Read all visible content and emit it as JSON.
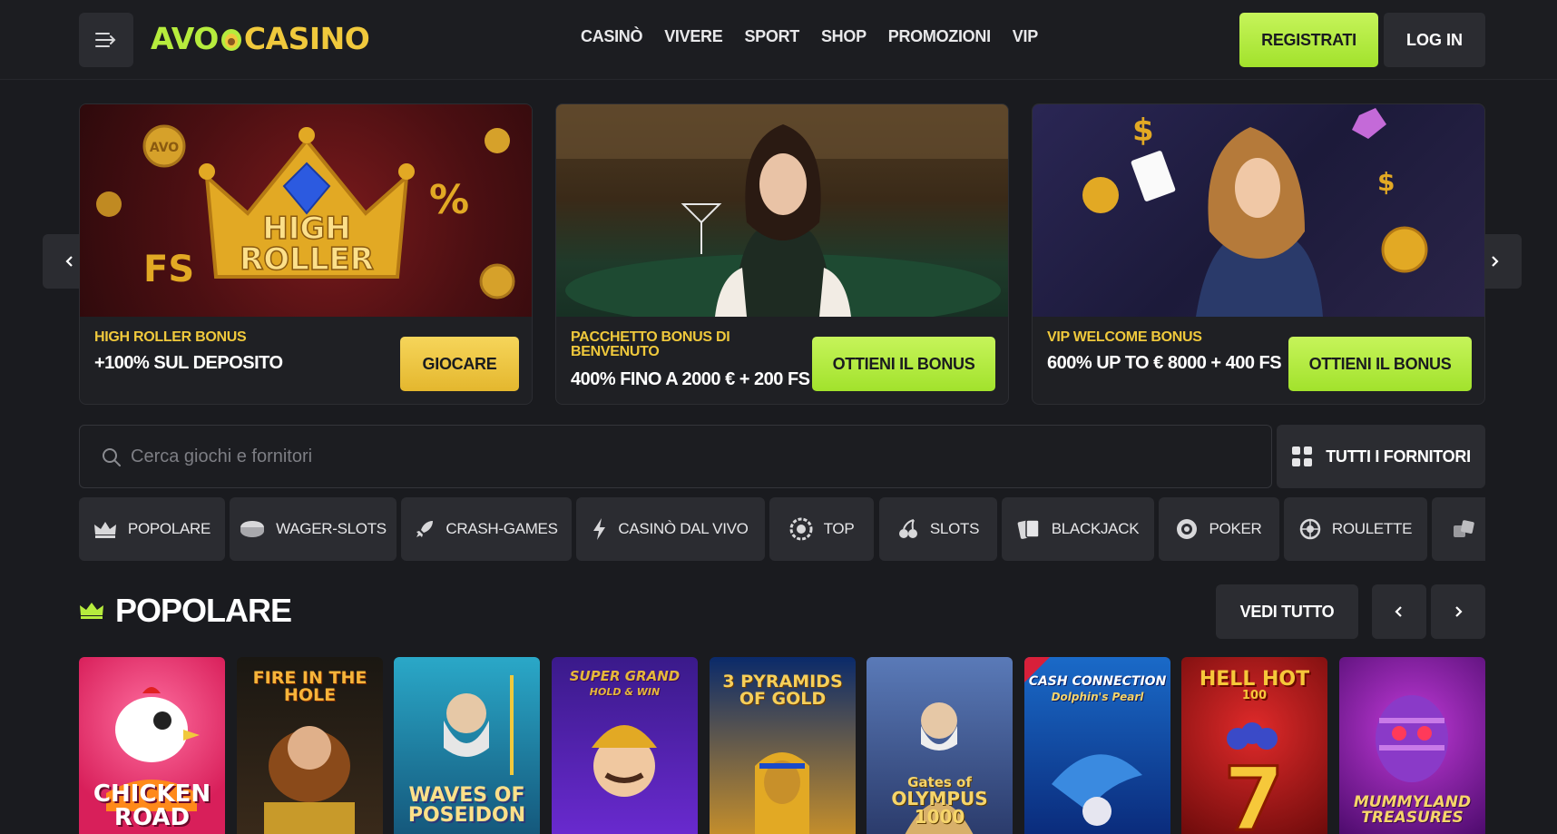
{
  "header": {
    "logo_left": "AVO",
    "logo_right": "CASINO",
    "nav": [
      "CASINÒ",
      "VIVERE",
      "SPORT",
      "SHOP",
      "PROMOZIONI",
      "VIP"
    ],
    "register_label": "REGISTRATI",
    "login_label": "LOG IN"
  },
  "banners": [
    {
      "title": "HIGH ROLLER BONUS",
      "desc": "+100% SUL DEPOSITO",
      "cta": "GIOCARE",
      "art_text_1": "HIGH",
      "art_text_2": "ROLLER",
      "art_fs": "FS",
      "art_pct": "%",
      "art_coin": "AVO"
    },
    {
      "title_1": "PACCHETTO BONUS DI",
      "title_2": "BENVENUTO",
      "desc": "400% FINO A 2000 € + 200 FS",
      "cta": "OTTIENI IL BONUS"
    },
    {
      "title": "VIP WELCOME BONUS",
      "desc": "600% UP TO € 8000 + 400 FS",
      "cta": "OTTIENI IL BONUS"
    }
  ],
  "search": {
    "placeholder": "Cerca giochi e fornitori",
    "providers_label": "TUTTI I FORNITORI"
  },
  "categories": [
    {
      "label": "POPOLARE",
      "icon": "crown-icon"
    },
    {
      "label": "WAGER-SLOTS",
      "icon": "chip-icon"
    },
    {
      "label": "CRASH-GAMES",
      "icon": "rocket-icon"
    },
    {
      "label": "CASINÒ DAL VIVO",
      "icon": "lightning-icon"
    },
    {
      "label": "TOP",
      "icon": "badge-icon"
    },
    {
      "label": "SLOTS",
      "icon": "cherry-icon"
    },
    {
      "label": "BLACKJACK",
      "icon": "cards-icon"
    },
    {
      "label": "POKER",
      "icon": "poker-chip-icon"
    },
    {
      "label": "ROULETTE",
      "icon": "roulette-icon"
    }
  ],
  "popular": {
    "title": "POPOLARE",
    "see_all_label": "VEDI TUTTO"
  },
  "games": [
    {
      "name_1": "CHICKEN",
      "name_2": "ROAD"
    },
    {
      "name_1": "FIRE IN THE HOLE",
      "name_2": ""
    },
    {
      "name_1": "WAVES OF",
      "name_2": "POSEIDON"
    },
    {
      "name_1": "SUPER GRAND",
      "name_2": "HOLD & WIN"
    },
    {
      "name_1": "3 PYRAMIDS",
      "name_2": "OF GOLD"
    },
    {
      "name_1": "Gates of",
      "name_2": "OLYMPUS 1000"
    },
    {
      "name_1": "CASH CONNECTION",
      "name_2": "Dolphin's Pearl"
    },
    {
      "name_1": "HELL HOT",
      "name_2": "100"
    },
    {
      "name_1": "MUMMYLAND",
      "name_2": "TREASURES"
    }
  ],
  "colors": {
    "accent_green": "#b6ec3d",
    "accent_yellow": "#f0c93c",
    "background": "#1a1b1f",
    "panel": "#2b2c31"
  }
}
